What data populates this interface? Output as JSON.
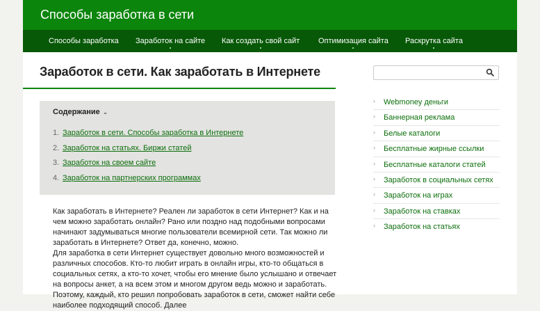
{
  "site": {
    "title": "Способы заработка в сети"
  },
  "nav": [
    {
      "label": "Способы заработка"
    },
    {
      "label": "Заработок на сайте"
    },
    {
      "label": "Как создать свой сайт"
    },
    {
      "label": "Оптимизация сайта"
    },
    {
      "label": "Раскрутка сайта"
    }
  ],
  "page": {
    "title": "Заработок в сети. Как заработать в Интернете"
  },
  "toc": {
    "heading": "Содержание",
    "chevron": "⌄",
    "items": [
      {
        "num": "1.",
        "label": "Заработок в сети. Способы заработка в Интернете"
      },
      {
        "num": "2.",
        "label": "Заработок на статьях. Биржи статей"
      },
      {
        "num": "3.",
        "label": "Заработок на своем сайте"
      },
      {
        "num": "4.",
        "label": "Заработок на партнерских программах"
      }
    ]
  },
  "article": {
    "p1": "Как заработать в Интернете? Реален ли заработок в сети Интернет? Как и на чем можно заработать онлайн? Рано или поздно над подобными вопросами начинают задумываться многие пользователи всемирной сети. Так можно ли заработать в Интернете? Ответ да, конечно, можно.",
    "p2": "Для заработка в сети Интернет существует довольно много возможностей и различных способов. Кто-то любит играть в онлайн игры, кто-то общаться в социальных сетях, а кто-то хочет, чтобы его мнение было услышано и отвечает на вопросы анкет, а на всем этом и многом другом ведь можно и заработать. Поэтому, каждый, кто решил попробовать заработок в сети, сможет найти себе наиболее подходящий способ. Далее"
  },
  "search": {
    "icon": "search-icon"
  },
  "sidebar": {
    "arrow": "›",
    "items": [
      {
        "label": "Webmoney деньги"
      },
      {
        "label": "Баннерная реклама"
      },
      {
        "label": "Белые каталоги"
      },
      {
        "label": "Бесплатные жирные ссылки"
      },
      {
        "label": "Бесплатные каталоги статей"
      },
      {
        "label": "Заработок в социальных сетях"
      },
      {
        "label": "Заработок на играх"
      },
      {
        "label": "Заработок на ставках"
      },
      {
        "label": "Заработок на статьях"
      }
    ]
  },
  "colors": {
    "header": "#0b850b",
    "nav": "#075807",
    "link": "#0b6e0b",
    "toc_bg": "#e3e3e1"
  }
}
